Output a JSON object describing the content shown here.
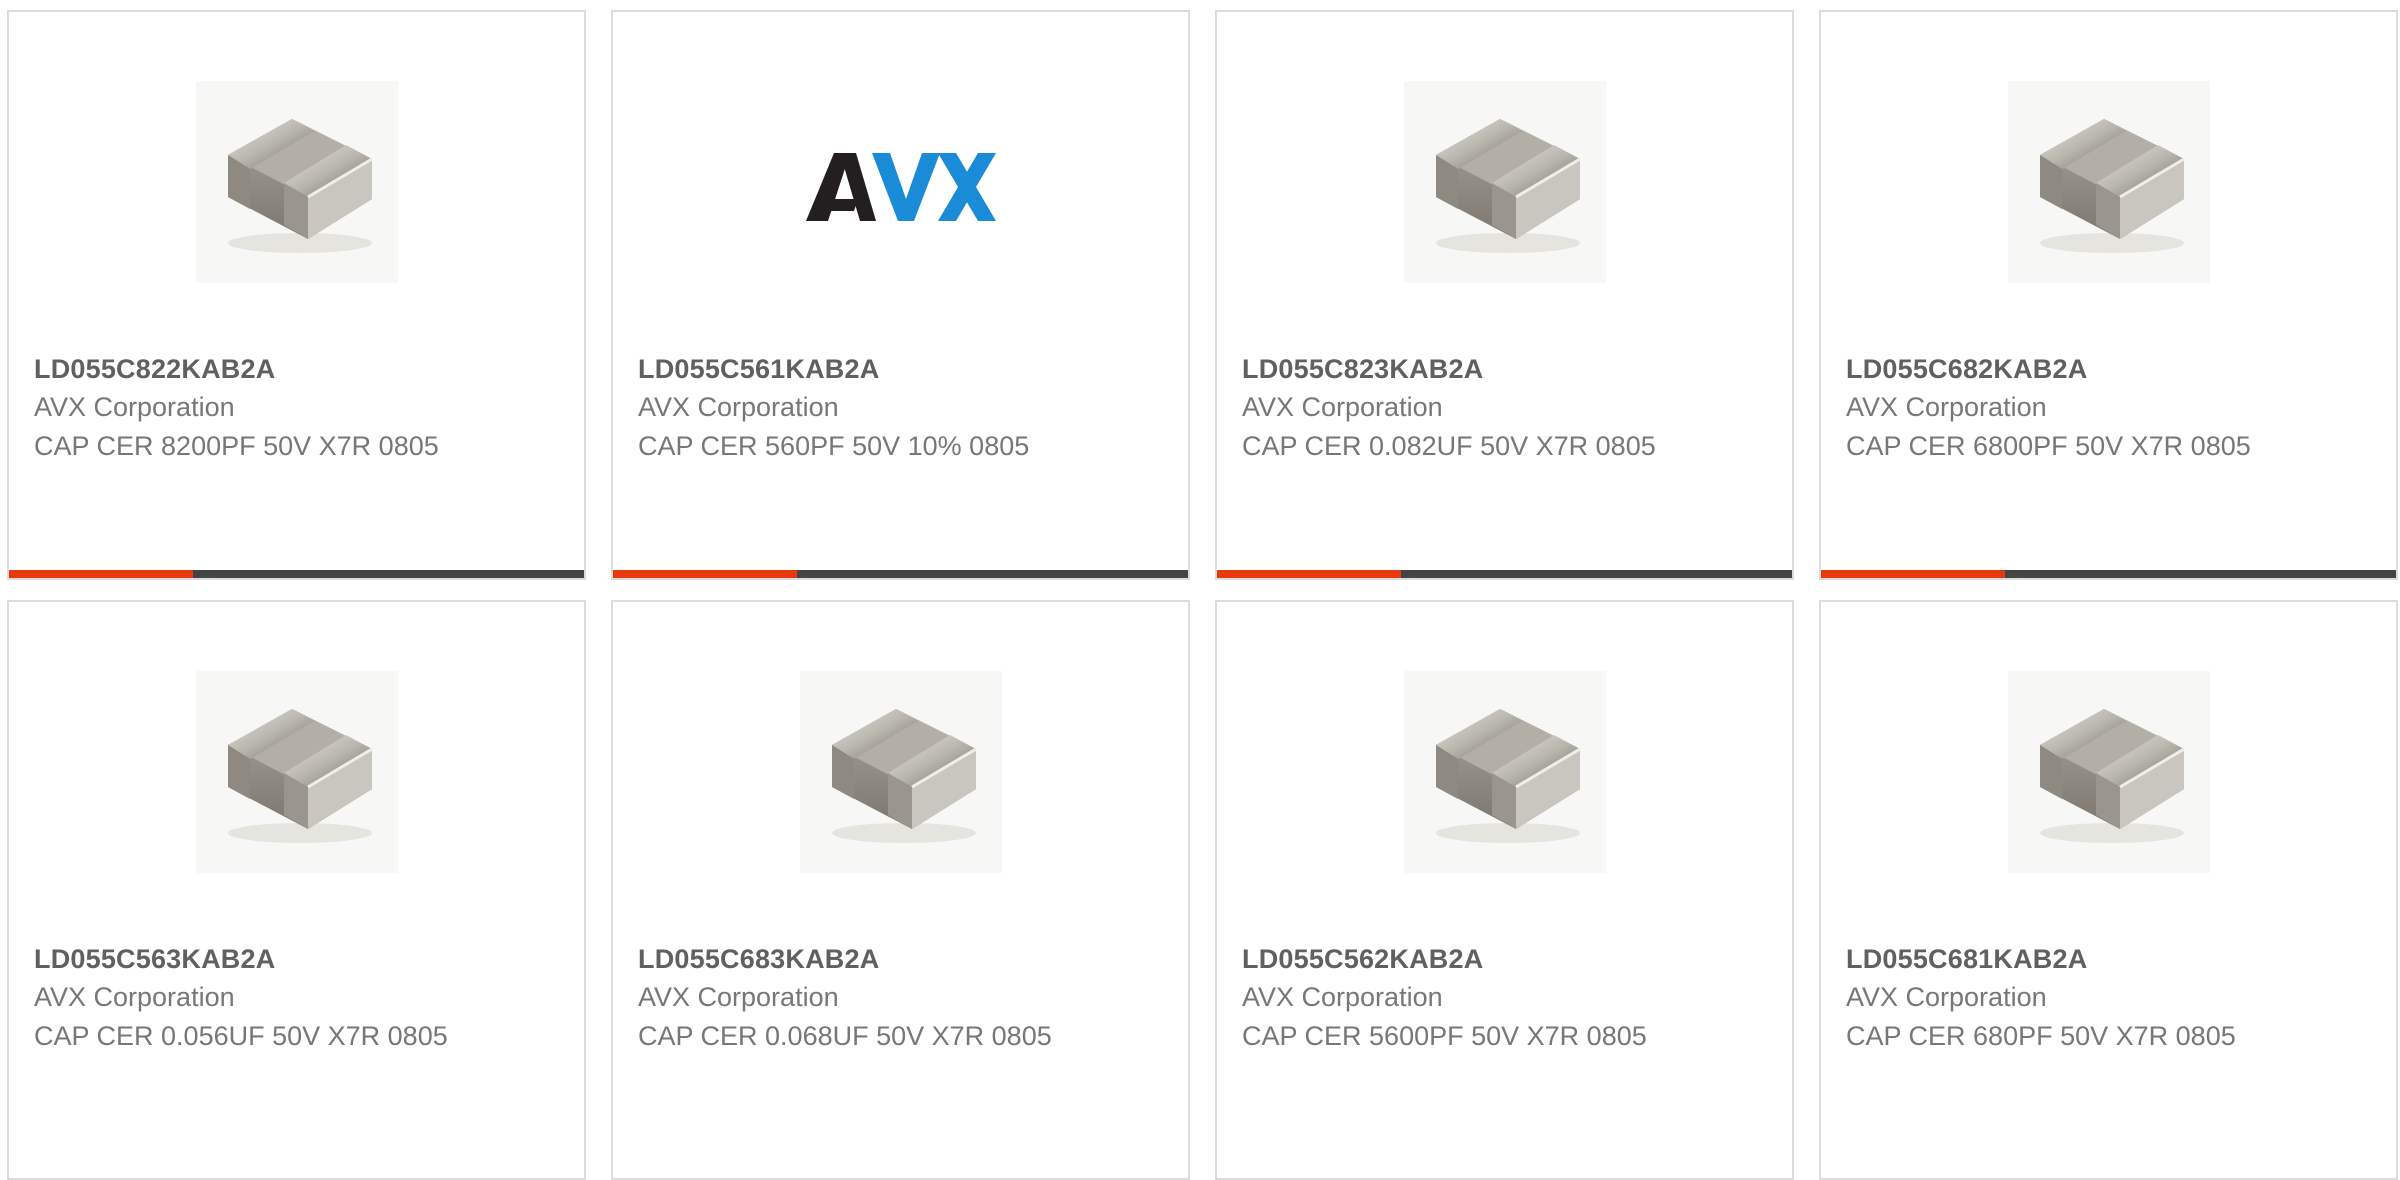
{
  "products": [
    {
      "part_number": "LD055C822KAB2A",
      "manufacturer": "AVX Corporation",
      "description": "CAP CER 8200PF 50V X7R 0805",
      "image": "ceramic-capacitor-chip",
      "progress_fraction": 0.32
    },
    {
      "part_number": "LD055C561KAB2A",
      "manufacturer": "AVX Corporation",
      "description": "CAP CER 560PF 50V 10% 0805",
      "image": "avx-logo",
      "logo_text": "AVX",
      "progress_fraction": 0.32
    },
    {
      "part_number": "LD055C823KAB2A",
      "manufacturer": "AVX Corporation",
      "description": "CAP CER 0.082UF 50V X7R 0805",
      "image": "ceramic-capacitor-chip",
      "progress_fraction": 0.32
    },
    {
      "part_number": "LD055C682KAB2A",
      "manufacturer": "AVX Corporation",
      "description": "CAP CER 6800PF 50V X7R 0805",
      "image": "ceramic-capacitor-chip",
      "progress_fraction": 0.32
    },
    {
      "part_number": "LD055C563KAB2A",
      "manufacturer": "AVX Corporation",
      "description": "CAP CER 0.056UF 50V X7R 0805",
      "image": "ceramic-capacitor-chip"
    },
    {
      "part_number": "LD055C683KAB2A",
      "manufacturer": "AVX Corporation",
      "description": "CAP CER 0.068UF 50V X7R 0805",
      "image": "ceramic-capacitor-chip"
    },
    {
      "part_number": "LD055C562KAB2A",
      "manufacturer": "AVX Corporation",
      "description": "CAP CER 5600PF 50V X7R 0805",
      "image": "ceramic-capacitor-chip"
    },
    {
      "part_number": "LD055C681KAB2A",
      "manufacturer": "AVX Corporation",
      "description": "CAP CER 680PF 50V X7R 0805",
      "image": "ceramic-capacitor-chip"
    }
  ],
  "colors": {
    "accent": "#e8380d",
    "bar_track": "#444444",
    "card_border": "#dcdcdc",
    "avx_dark": "#231f20",
    "avx_blue": "#1a8bd6"
  }
}
